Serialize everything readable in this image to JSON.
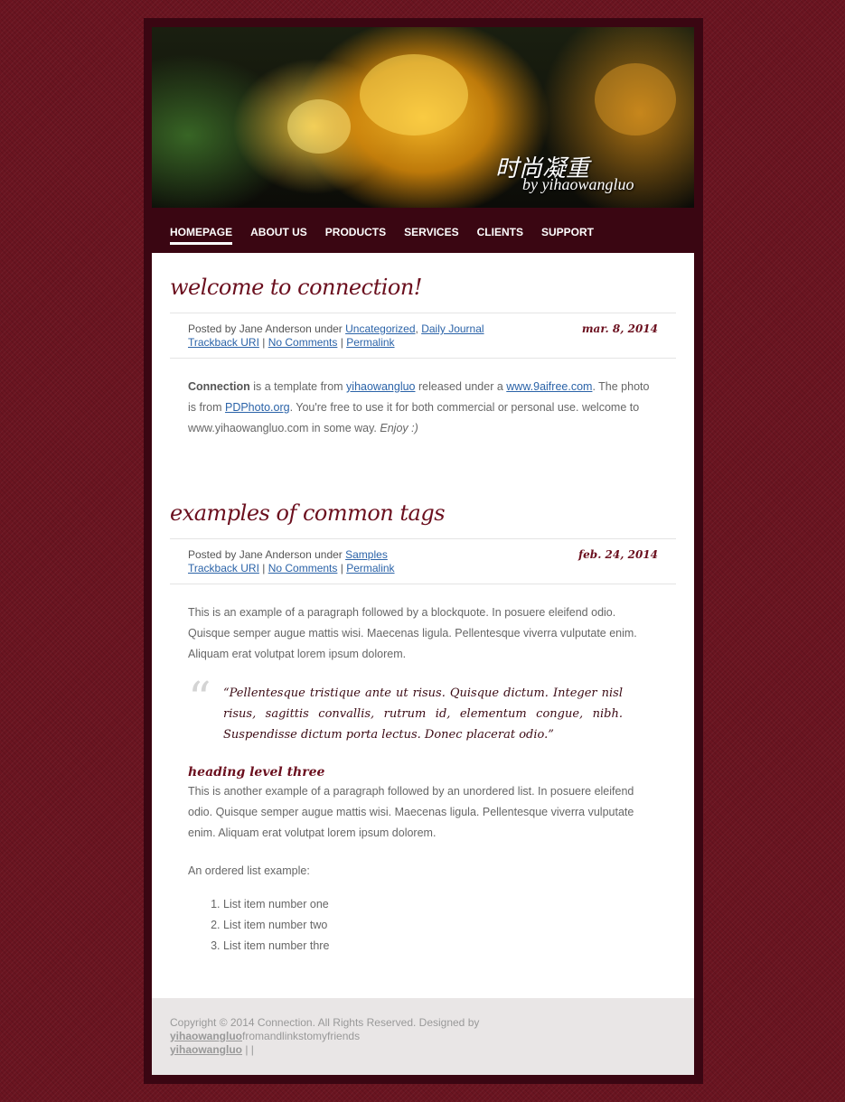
{
  "header": {
    "title_zh": "时尚凝重",
    "byline": "by yihaowangluo"
  },
  "nav": {
    "items": [
      {
        "label": "HOMEPAGE"
      },
      {
        "label": "ABOUT US"
      },
      {
        "label": "PRODUCTS"
      },
      {
        "label": "SERVICES"
      },
      {
        "label": "CLIENTS"
      },
      {
        "label": "SUPPORT"
      }
    ]
  },
  "posts": [
    {
      "title": "welcome to connection!",
      "posted_by": "Posted by Jane Anderson under ",
      "categories": [
        "Uncategorized",
        "Daily Journal"
      ],
      "date": "mar. 8, 2014",
      "links": {
        "trackback": "Trackback URI",
        "comments": "No Comments",
        "permalink": "Permalink"
      },
      "body": {
        "strong": "Connection",
        "t1": " is a template from ",
        "link1": "yihaowangluo",
        "t2": " released under a ",
        "link2": "www.9aifree.com",
        "t3": ". The photo is from ",
        "link3": "PDPhoto.org",
        "t4": ". You're free to use it for both commercial or personal use. welcome to www.yihaowangluo.com in some way. ",
        "em": "Enjoy :)"
      }
    },
    {
      "title": "examples of common tags",
      "posted_by": "Posted by Jane Anderson under ",
      "categories": [
        "Samples"
      ],
      "date": "feb. 24, 2014",
      "links": {
        "trackback": "Trackback URI",
        "comments": "No Comments",
        "permalink": "Permalink"
      },
      "para1": "This is an example of a paragraph followed by a blockquote. In posuere eleifend odio. Quisque semper augue mattis wisi. Maecenas ligula. Pellentesque viverra vulputate enim. Aliquam erat volutpat lorem ipsum dolorem.",
      "blockquote": "“Pellentesque tristique ante ut risus. Quisque dictum. Integer nisl risus, sagittis convallis, rutrum id, elementum congue, nibh. Suspendisse dictum porta lectus. Donec placerat odio.”",
      "quote_mark": "“",
      "heading3": "heading level three",
      "para2": "This is another example of a paragraph followed by an unordered list. In posuere eleifend odio. Quisque semper augue mattis wisi. Maecenas ligula. Pellentesque viverra vulputate enim. Aliquam erat volutpat lorem ipsum dolorem.",
      "para3": "An ordered list example:",
      "list": [
        "List item number one",
        "List item number two",
        "List item number thre"
      ]
    }
  ],
  "footer": {
    "copyright": "Copyright © 2014 Connection. All Rights Reserved. Designed by",
    "link1": "yihaowangluo",
    "text1": "fromandlinkstomyfriends",
    "link2": "yihaowangluo",
    "text2": " | |"
  },
  "colors": {
    "page_bg": "#6a1420",
    "frame": "#3a0612",
    "title": "#6b0f1e",
    "link": "#2b63a8",
    "footer_bg": "#e9e6e6"
  }
}
